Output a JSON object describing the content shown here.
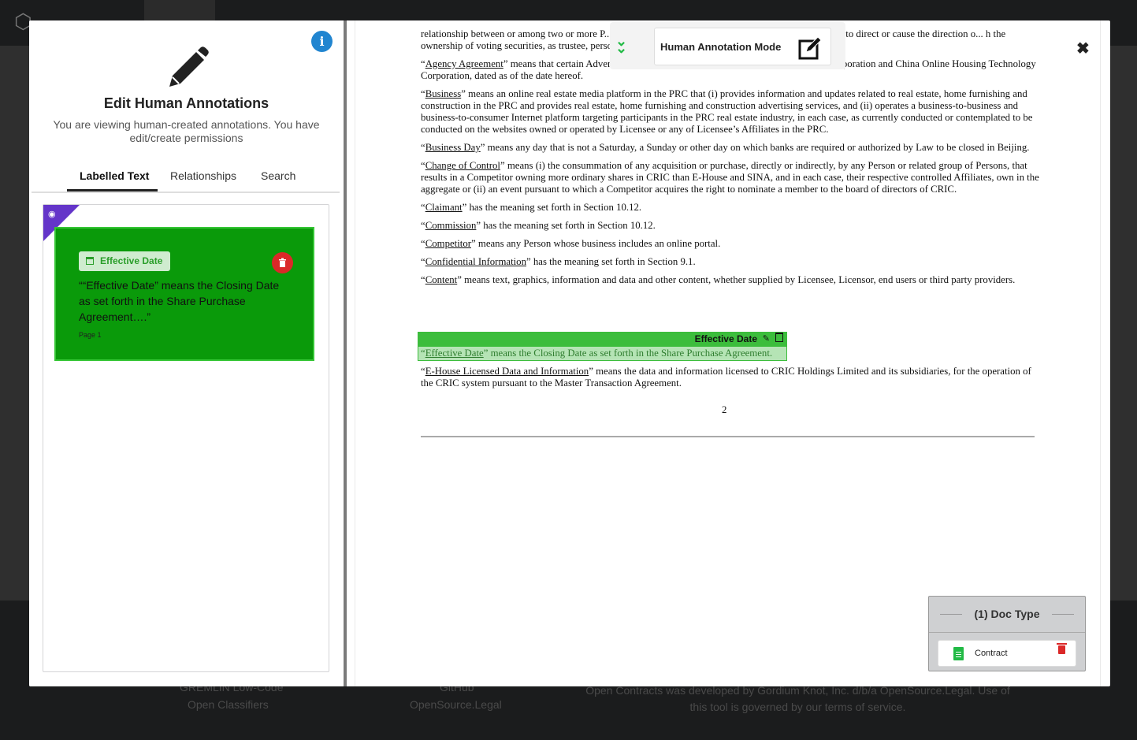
{
  "background": {
    "footer_links": [
      "Open Classifiers",
      "OpenSource.Legal"
    ],
    "footer_links_faint": [
      "GREMLIN Low-Code",
      "GitHub"
    ],
    "footer_copy": "Open Contracts was developed by Gordium Knot, Inc. d/b/a OpenSource.Legal. Use of this tool is governed by our terms of service."
  },
  "left_panel": {
    "title": "Edit Human Annotations",
    "subtitle": "You are viewing human-created annotations. You have edit/create permissions",
    "tabs": [
      {
        "label": "Labelled Text",
        "active": true
      },
      {
        "label": "Relationships",
        "active": false
      },
      {
        "label": "Search",
        "active": false
      }
    ],
    "annotation": {
      "label": "Effective Date",
      "text": "““Effective Date” means the Closing Date as set forth in the Share Purchase Agreement….”",
      "page": "Page 1",
      "card_color": "#0a9a0a"
    }
  },
  "mode": {
    "label": "Human Annotation Mode"
  },
  "document": {
    "paragraphs": [
      {
        "term": "",
        "rest": "relationship between or among two or more P... trustee, personal representative or executor, of the power to direct or cause the direction o... h the ownership of voting securities, as trustee, personal representative or executor, b..."
      },
      {
        "term": "Agency Agreement",
        "rest": "” means that certain Advertising Sale Agency Agreement by and between SINA Corporation and China Online Housing Technology Corporation, dated as of the date hereof."
      },
      {
        "term": "Business",
        "rest": "” means an online real estate media platform in the PRC that (i) provides information and updates related to real estate, home furnishing and construction in the PRC and provides real estate, home furnishing and construction advertising services, and (ii) operates a business-to-business and business-to-consumer Internet platform targeting participants in the PRC real estate industry, in each case, as currently conducted or contemplated to be conducted on the websites owned or operated by Licensee or any of Licensee’s Affiliates in the PRC."
      },
      {
        "term": "Business Day",
        "rest": "” means any day that is not a Saturday, a Sunday or other day on which banks are required or authorized by Law to be closed in Beijing."
      },
      {
        "term": "Change of Control",
        "rest": "” means (i) the consummation of any acquisition or purchase, directly or indirectly, by any Person or related group of Persons, that results in a Competitor owning more ordinary shares in CRIC than E-House and SINA, and in each case, their respective controlled Affiliates, own in the aggregate or (ii) an event pursuant to which a Competitor acquires the right to nominate a member to the board of directors of CRIC."
      },
      {
        "term": "Claimant",
        "rest": "” has the meaning set forth in Section 10.12."
      },
      {
        "term": "Commission",
        "rest": "” has the meaning set forth in Section 10.12."
      },
      {
        "term": "Competitor",
        "rest": "” means any Person whose business includes an online portal."
      },
      {
        "term": "Confidential Information",
        "rest": "” has the meaning set forth in Section 9.1."
      },
      {
        "term": "Content",
        "rest": "” means text, graphics, information and data and other content, whether supplied by Licensee, Licensor, end users or third party providers."
      }
    ],
    "highlight": {
      "label": "Effective Date",
      "term": "Effective Date",
      "rest": "” means the Closing Date as set forth in the Share Purchase Agreement.",
      "color": "#3cbd3c"
    },
    "after": {
      "term": "E-House Licensed Data and Information",
      "rest": "” means the data and information licensed to CRIC Holdings Limited and its subsidiaries, for the operation of the CRIC system pursuant to the Master Transaction Agreement."
    },
    "page_number": "2"
  },
  "doc_type": {
    "header": "(1) Doc Type",
    "items": [
      "Contract"
    ]
  }
}
